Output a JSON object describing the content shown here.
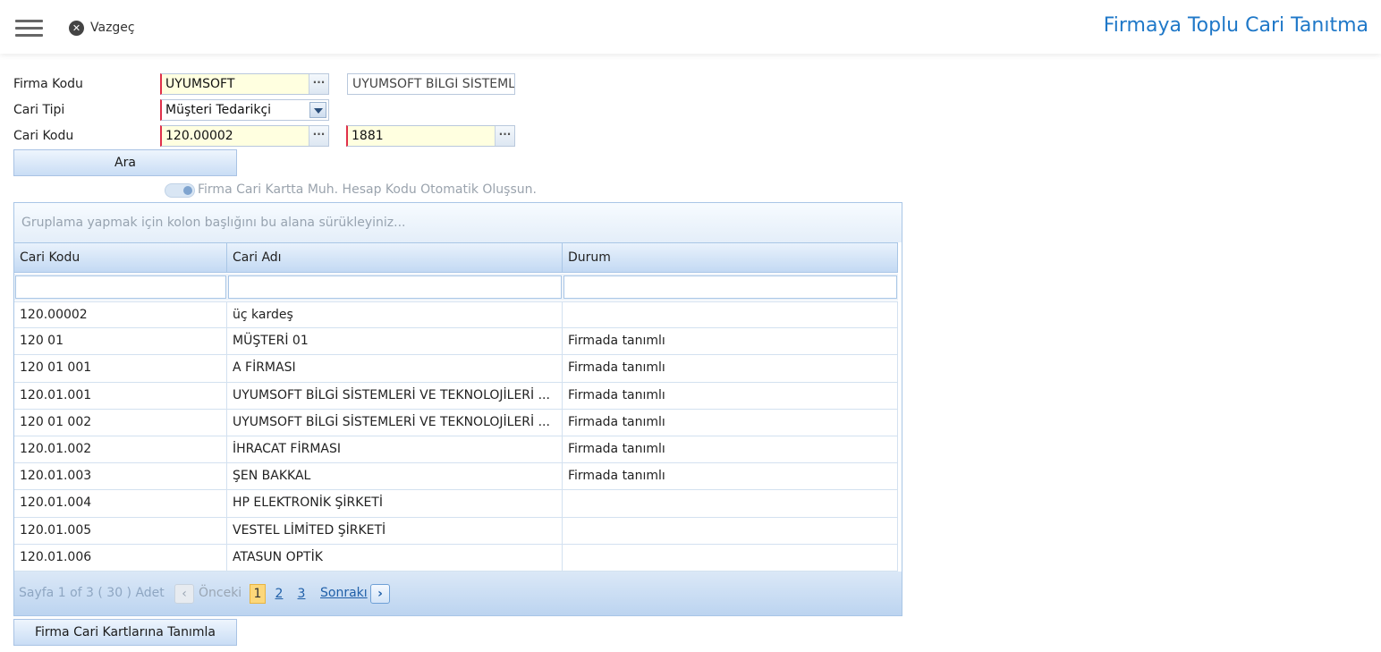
{
  "header": {
    "cancel_label": "Vazgeç",
    "title": "Firmaya Toplu Cari Tanıtma"
  },
  "form": {
    "firma_kodu_label": "Firma Kodu",
    "firma_kodu_value": "UYUMSOFT",
    "firma_adi_value": "UYUMSOFT BİLGİ SİSTEMLERİ",
    "cari_tipi_label": "Cari Tipi",
    "cari_tipi_value": "Müşteri Tedarikçi",
    "cari_kodu_label": "Cari Kodu",
    "cari_kodu_start": "120.00002",
    "cari_kodu_end": "1881",
    "search_button": "Ara",
    "toggle_label": "Firma Cari Kartta Muh. Hesap Kodu Otomatik Oluşsun."
  },
  "grid": {
    "group_panel_text": "Gruplama yapmak için kolon başlığını bu alana sürükleyiniz...",
    "columns": [
      "Cari Kodu",
      "Cari Adı",
      "Durum"
    ],
    "rows": [
      [
        "120.00002",
        "üç kardeş",
        ""
      ],
      [
        "120 01",
        "MÜŞTERİ 01",
        "Firmada tanımlı"
      ],
      [
        "120 01 001",
        "A FİRMASI",
        "Firmada tanımlı"
      ],
      [
        "120.01.001",
        "UYUMSOFT BİLGİ SİSTEMLERİ VE TEKNOLOJİLERİ ...",
        "Firmada tanımlı"
      ],
      [
        "120 01 002",
        "UYUMSOFT BİLGİ SİSTEMLERİ VE TEKNOLOJİLERİ ...",
        "Firmada tanımlı"
      ],
      [
        "120.01.002",
        "İHRACAT FİRMASI",
        "Firmada tanımlı"
      ],
      [
        "120.01.003",
        "ŞEN BAKKAL",
        "Firmada tanımlı"
      ],
      [
        "120.01.004",
        "HP ELEKTRONİK ŞİRKETİ",
        ""
      ],
      [
        "120.01.005",
        "VESTEL LİMİTED ŞİRKETİ",
        ""
      ],
      [
        "120.01.006",
        "ATASUN OPTİK",
        ""
      ]
    ],
    "pager": {
      "info": "Sayfa 1 of 3 ( 30 ) Adet",
      "prev": "Önceki",
      "pages": [
        "1",
        "2",
        "3"
      ],
      "next": "Sonrakı"
    }
  },
  "footer": {
    "assign_button": "Firma Cari Kartlarına Tanımla"
  }
}
